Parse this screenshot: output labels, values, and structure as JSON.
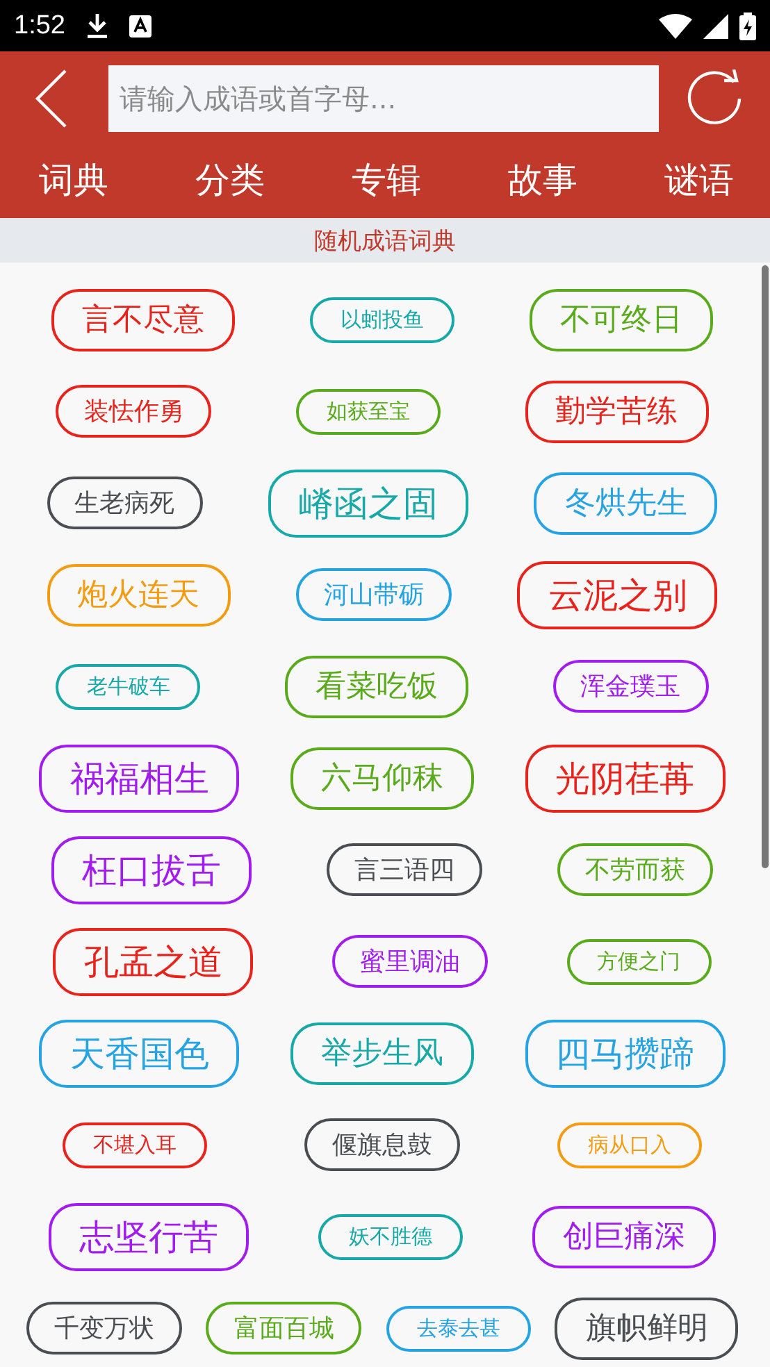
{
  "status_bar": {
    "time": "1:52"
  },
  "search": {
    "placeholder": "请输入成语或首字母..."
  },
  "tabs": [
    {
      "label": "词典"
    },
    {
      "label": "分类"
    },
    {
      "label": "专辑"
    },
    {
      "label": "故事"
    },
    {
      "label": "谜语"
    }
  ],
  "section_title": "随机成语词典",
  "tag_rows": [
    [
      {
        "text": "言不尽意",
        "color": "#e8231c",
        "kind": "large"
      },
      {
        "text": "以蚓投鱼",
        "color": "#17a8a8",
        "kind": "small"
      },
      {
        "text": "不可终日",
        "color": "#5aab1c",
        "kind": "large"
      }
    ],
    [
      {
        "text": "装怯作勇",
        "color": "#e8231c",
        "kind": "medium"
      },
      {
        "text": "如获至宝",
        "color": "#5aab1c",
        "kind": "small"
      },
      {
        "text": "勤学苦练",
        "color": "#e8231c",
        "kind": "large"
      }
    ],
    [
      {
        "text": "生老病死",
        "color": "#4a4d52",
        "kind": "medium"
      },
      {
        "text": "嵴函之固",
        "color": "#17a8a8",
        "kind": "xlarge"
      },
      {
        "text": "冬烘先生",
        "color": "#25a3e3",
        "kind": "large"
      }
    ],
    [
      {
        "text": "炮火连天",
        "color": "#f39c12",
        "kind": "large"
      },
      {
        "text": "河山带砺",
        "color": "#25a3e3",
        "kind": "medium"
      },
      {
        "text": "云泥之别",
        "color": "#e8231c",
        "kind": "xlarge"
      }
    ],
    [
      {
        "text": "老牛破车",
        "color": "#17a8a8",
        "kind": "small"
      },
      {
        "text": "看菜吃饭",
        "color": "#5aab1c",
        "kind": "large"
      },
      {
        "text": "浑金璞玉",
        "color": "#a21cf0",
        "kind": "medium"
      }
    ],
    [
      {
        "text": "祸福相生",
        "color": "#a21cf0",
        "kind": "xlarge"
      },
      {
        "text": "六马仰秣",
        "color": "#5aab1c",
        "kind": "large"
      },
      {
        "text": "光阴荏苒",
        "color": "#e8231c",
        "kind": "xlarge"
      }
    ],
    [
      {
        "text": "枉口拔舌",
        "color": "#a21cf0",
        "kind": "xlarge"
      },
      {
        "text": "言三语四",
        "color": "#4a4d52",
        "kind": "medium"
      },
      {
        "text": "不劳而获",
        "color": "#5aab1c",
        "kind": "medium"
      }
    ],
    [
      {
        "text": "孔孟之道",
        "color": "#e8231c",
        "kind": "xlarge"
      },
      {
        "text": "蜜里调油",
        "color": "#a21cf0",
        "kind": "medium"
      },
      {
        "text": "方便之门",
        "color": "#5aab1c",
        "kind": "small"
      }
    ],
    [
      {
        "text": "天香国色",
        "color": "#25a3e3",
        "kind": "xlarge"
      },
      {
        "text": "举步生风",
        "color": "#17a8a8",
        "kind": "large"
      },
      {
        "text": "四马攒蹄",
        "color": "#25a3e3",
        "kind": "xlarge"
      }
    ],
    [
      {
        "text": "不堪入耳",
        "color": "#e8231c",
        "kind": "small"
      },
      {
        "text": "偃旗息鼓",
        "color": "#4a4d52",
        "kind": "medium"
      },
      {
        "text": "病从口入",
        "color": "#f39c12",
        "kind": "small"
      }
    ],
    [
      {
        "text": "志坚行苦",
        "color": "#a21cf0",
        "kind": "xlarge"
      },
      {
        "text": "妖不胜德",
        "color": "#17a8a8",
        "kind": "small"
      },
      {
        "text": "创巨痛深",
        "color": "#a21cf0",
        "kind": "large"
      }
    ],
    [
      {
        "text": "千变万状",
        "color": "#4a4d52",
        "kind": "medium"
      },
      {
        "text": "富面百城",
        "color": "#5aab1c",
        "kind": "medium"
      },
      {
        "text": "去泰去甚",
        "color": "#25a3e3",
        "kind": "small"
      },
      {
        "text": "旗帜鲜明",
        "color": "#4a4d52",
        "kind": "large"
      }
    ]
  ]
}
